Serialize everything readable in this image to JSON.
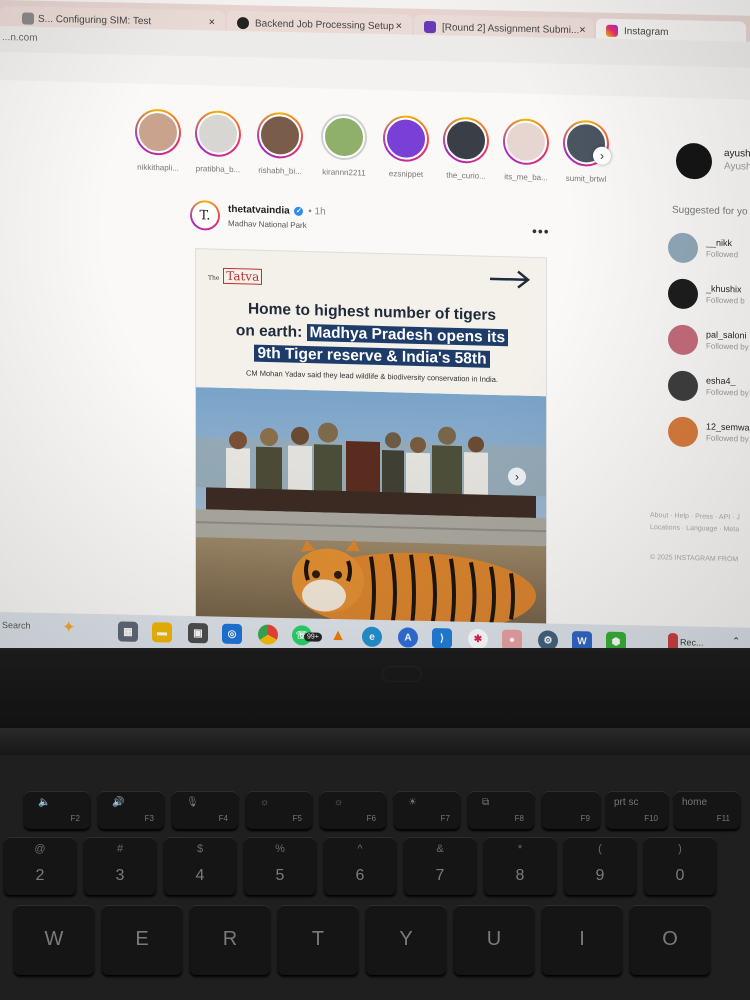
{
  "tabs": [
    {
      "title": "S... Configuring SIM: Test",
      "close": "×",
      "color": "#777"
    },
    {
      "title": "Backend Job Processing Setup",
      "close": "×",
      "color": "#222"
    },
    {
      "title": "[Round 2] Assignment Submi...",
      "close": "×",
      "color": "#673ab7"
    },
    {
      "title": "Instagram",
      "close": "",
      "color": "#e1306c"
    }
  ],
  "address": {
    "url": "...n.com"
  },
  "stories": [
    {
      "name": "nikkithapli...",
      "seen": false,
      "color": "#c9a38d"
    },
    {
      "name": "pratibha_b...",
      "seen": false,
      "color": "#d8d6d2"
    },
    {
      "name": "rishabh_bi...",
      "seen": false,
      "color": "#7a5c4a"
    },
    {
      "name": "kirannn2211",
      "seen": true,
      "color": "#8fb06a"
    },
    {
      "name": "ezsnippet",
      "seen": false,
      "color": "#7a3fd6"
    },
    {
      "name": "the_curio...",
      "seen": false,
      "color": "#3a3f47"
    },
    {
      "name": "its_me_ba...",
      "seen": false,
      "color": "#e6d5d0"
    },
    {
      "name": "sumit_brtwl",
      "seen": false,
      "color": "#4a5561"
    }
  ],
  "story_next": "›",
  "post": {
    "username": "thetatvaindia",
    "verified_mark": "✓",
    "time": "• 1h",
    "location": "Madhav National Park",
    "more": "•••",
    "avatar_letter": "T.",
    "brand_prefix": "The",
    "brand_name": "Tatva",
    "headline_line1": "Home to highest number of tigers",
    "headline_line2_plain": "on earth:",
    "headline_line2_highlight": "Madhya Pradesh opens its",
    "headline_line3_highlight": "9th Tiger reserve & India's 58th",
    "subline": "CM Mohan Yadav said they lead wildlife & biodiversity conservation in India.",
    "slide_next": "›"
  },
  "sidebar": {
    "me_username": "ayush_",
    "me_name": "Ayush I",
    "suggested_title": "Suggested for yo",
    "suggestions": [
      {
        "username": "__nikk",
        "followed": "Followed",
        "color": "#8fa8b8"
      },
      {
        "username": "_khushix",
        "followed": "Followed b",
        "color": "#1a1a1a"
      },
      {
        "username": "pal_saloni",
        "followed": "Followed by",
        "color": "#c46a7a"
      },
      {
        "username": "esha4_",
        "followed": "Followed by",
        "color": "#3b3b3b"
      },
      {
        "username": "12_semwal",
        "followed": "Followed by _",
        "color": "#d87a3a"
      }
    ],
    "footer_line1": "About · Help · Press · API · J",
    "footer_line2": "Locations · Language · Meta",
    "copyright": "© 2025 INSTAGRAM FROM"
  },
  "taskbar": {
    "search": "Search",
    "badge": "99+",
    "rec_label": "Rec..."
  },
  "keyboard": {
    "frow": [
      {
        "label": "F2",
        "icon": "🔈"
      },
      {
        "label": "F3",
        "icon": "🔊"
      },
      {
        "label": "F4",
        "icon": "🎙"
      },
      {
        "label": "F5",
        "icon": "☼"
      },
      {
        "label": "F6",
        "icon": "☼"
      },
      {
        "label": "F7",
        "icon": "☀"
      },
      {
        "label": "F8",
        "icon": "⧉"
      },
      {
        "label": "F9",
        "icon": ""
      },
      {
        "label": "F10",
        "icon": "prt sc"
      },
      {
        "label": "F11",
        "icon": "home"
      }
    ],
    "numrow": [
      {
        "top": "@",
        "main": "2"
      },
      {
        "top": "#",
        "main": "3"
      },
      {
        "top": "$",
        "main": "4"
      },
      {
        "top": "%",
        "main": "5"
      },
      {
        "top": "^",
        "main": "6"
      },
      {
        "top": "&",
        "main": "7"
      },
      {
        "top": "*",
        "main": "8"
      },
      {
        "top": "(",
        "main": "9"
      },
      {
        "top": ")",
        "main": "0"
      }
    ],
    "letters": [
      "W",
      "E",
      "R",
      "T",
      "Y",
      "U",
      "I",
      "O"
    ]
  }
}
